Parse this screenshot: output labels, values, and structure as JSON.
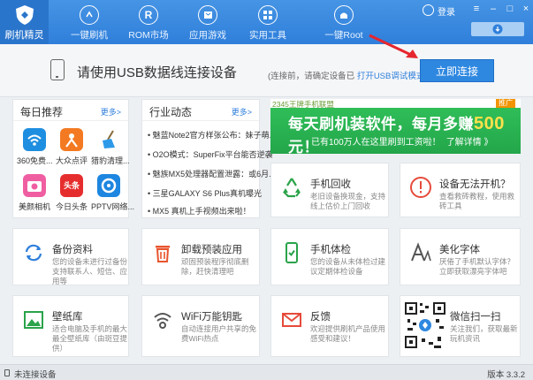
{
  "header": {
    "app_name": "刷机精灵",
    "nav": [
      "一键刷机",
      "ROM市场",
      "应用游戏",
      "实用工具",
      "一键Root"
    ],
    "user_label": "登录"
  },
  "connect": {
    "title": "请使用USB数据线连接设备",
    "hint": "(连接前，请确定设备已",
    "hint_link": "打开USB调试模式",
    "hint_end": ")",
    "button": "立即连接"
  },
  "daily": {
    "title": "每日推荐",
    "more": "更多>",
    "apps": [
      {
        "label": "360免费...",
        "color": "#1e8ee0",
        "icon": "wifi-app-icon"
      },
      {
        "label": "大众点评",
        "color": "#f37a22",
        "icon": "dianping-app-icon"
      },
      {
        "label": "猎豹清理...",
        "color": "#2c9ae8",
        "icon": "broom-app-icon"
      },
      {
        "label": "美颜相机",
        "color": "#f05ea2",
        "icon": "camera-app-icon"
      },
      {
        "label": "今日头条",
        "color": "#e62d2d",
        "icon": "toutiao-app-icon"
      },
      {
        "label": "PPTV网络...",
        "color": "#1d86e0",
        "icon": "pptv-app-icon"
      }
    ]
  },
  "news": {
    "title": "行业动态",
    "more": "更多>",
    "items": [
      "魅蓝Note2官方样张公布：妹子萌...",
      "O2O模式：SuperFix平台能否逆袭",
      "魅族MX5处理器配置泄露：或6月...",
      "三星GALAXY S6 Plus真机曝光",
      "MX5 真机上手视频出来啦！"
    ]
  },
  "banner": {
    "tag": "2345王牌手机联盟",
    "ad": "推广",
    "main_pre": "每天刷机装软件，每月多赚",
    "main_num": "500",
    "main_post": "元！",
    "sub_pre": "已有100万人在这里刷到工资啦！",
    "sub_link": "了解详情 》"
  },
  "tiles": [
    {
      "title": "手机回收",
      "desc": "老旧设备换现金，支持线上估价上门回收",
      "icon": "recycle-icon"
    },
    {
      "title": "设备无法开机？",
      "desc": "查看救砖教程，使用救砖工具",
      "icon": "warning-icon"
    },
    {
      "title": "备份资料",
      "desc": "您的设备未进行过备份支持联系人、短信、应用等",
      "icon": "sync-icon"
    },
    {
      "title": "卸载预装应用",
      "desc": "顽固预装程序彻底删除，赶快清理吧",
      "icon": "trash-icon"
    },
    {
      "title": "手机体检",
      "desc": "您的设备从未体检过建议定期体检设备",
      "icon": "phone-check-icon"
    },
    {
      "title": "美化字体",
      "desc": "厌倦了手机默认字体？立即获取漂亮字体吧",
      "icon": "font-icon"
    },
    {
      "title": "壁纸库",
      "desc": "适合电脑及手机的最大最全壁纸库（由斑豆提供）",
      "icon": "wallpaper-icon"
    },
    {
      "title": "WiFi万能钥匙",
      "desc": "自动连接用户共享的免费WiFi热点",
      "icon": "wifi-key-icon"
    },
    {
      "title": "反馈",
      "desc": "欢迎提供刷机产品使用感受和建议！",
      "icon": "mail-icon"
    },
    {
      "title": "微信扫一扫",
      "desc": "关注我们，获取最新玩机资讯",
      "icon": "qr-code-icon"
    }
  ],
  "status": {
    "left": "未连接设备",
    "right": "版本 3.3.2"
  }
}
